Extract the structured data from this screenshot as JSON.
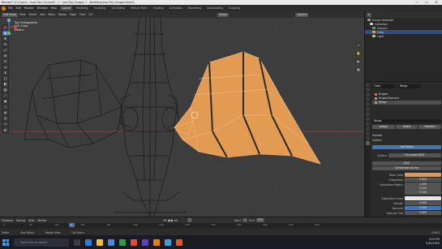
{
  "window": {
    "title": "Blender* [C:\\Users\\...\\Low Poly Course\\2 - 1 - Low Poly Dragon 1 - Modeling\\Low Poly Dragon.blend]",
    "controls": [
      "—",
      "☐",
      "✕"
    ]
  },
  "menubar": {
    "menus": [
      "File",
      "Edit",
      "Render",
      "Window",
      "Help"
    ],
    "workspaces": [
      "Layout",
      "Modeling",
      "Sculpting",
      "UV Editing",
      "Texture Paint",
      "Shading",
      "Animation",
      "Rendering",
      "Compositing",
      "Scripting"
    ],
    "active_workspace": "Layout"
  },
  "viewport_header": {
    "mode": "Edit Mode",
    "menus": [
      "View",
      "Select",
      "Add",
      "Mesh",
      "Vertex",
      "Edge",
      "Face",
      "UV"
    ],
    "transform": "Global",
    "shading": "Options"
  },
  "viewport": {
    "info_line1": "Top Orthographic",
    "info_line2": "(14) Cube",
    "info_line3": "Meters",
    "tools": [
      "cursor",
      "select",
      "move",
      "rotate",
      "scale",
      "transform",
      "annotate",
      "measure",
      "extrude",
      "inset",
      "bevel",
      "loopcut",
      "knife",
      "polybuild",
      "spin",
      "smooth",
      "shrink",
      "shear",
      "rip"
    ],
    "gizmo_labels": [
      "Z",
      "Y",
      "X"
    ],
    "colors": {
      "background": "#3d3d3d",
      "selected_face": "#e39a52",
      "wire": "#1b1b1b",
      "grid": "#454545",
      "axis_x": "#b23a3a"
    }
  },
  "outliner": {
    "title": "Scene Collection",
    "rows": [
      {
        "label": "Scene Collection",
        "color": "#9a9a9a",
        "selected": false
      },
      {
        "label": "Collection",
        "color": "#cfcfcf",
        "selected": false
      },
      {
        "label": "Camera",
        "color": "#5fa05f",
        "selected": false
      },
      {
        "label": "Cube",
        "color": "#e3994f",
        "selected": true
      },
      {
        "label": "Light",
        "color": "#d8c15a",
        "selected": false
      }
    ]
  },
  "properties": {
    "object_name": "Cube",
    "modifier_field": "Wings",
    "material_slots": [
      {
        "label": "Dragon",
        "color": "#e3994f",
        "selected": false
      },
      {
        "label": "DragonStomach",
        "color": "#b0b0b0",
        "selected": false
      },
      {
        "label": "Wings",
        "color": "#e3994f",
        "selected": true
      }
    ],
    "slot_buttons": [
      "Assign",
      "Select",
      "Deselect"
    ],
    "material_name": "Wings",
    "section_preview": "Preview",
    "section_surface": "Surface",
    "use_nodes": "Use Nodes",
    "surface_label": "Surface",
    "surface_value": "Principled BSDF",
    "distribution": "GGX",
    "subsurface_method": "Christensen-Burley",
    "fields": [
      {
        "label": "Base Color",
        "value": "",
        "type": "blue"
      },
      {
        "label": "Subsurface",
        "value": "0.000",
        "type": "normal"
      },
      {
        "label": "Subsurface Radius",
        "value": "1.000",
        "type": "normal"
      },
      {
        "label": "",
        "value": "0.200",
        "type": "normal"
      },
      {
        "label": "",
        "value": "0.100",
        "type": "normal"
      },
      {
        "label": "Subsurface Color",
        "value": "",
        "type": "dark"
      },
      {
        "label": "Metallic",
        "value": "0.000",
        "type": "normal"
      },
      {
        "label": "Specular",
        "value": "0.500",
        "type": "blue"
      },
      {
        "label": "Specular Tint",
        "value": "0.000",
        "type": "normal"
      },
      {
        "label": "Roughness",
        "value": "0.500",
        "type": "blue"
      },
      {
        "label": "Anisotropic",
        "value": "0.000",
        "type": "normal"
      }
    ]
  },
  "timeline": {
    "menus": [
      "Playback",
      "Keying",
      "View",
      "Marker"
    ],
    "ticks": [
      "0",
      "20",
      "40",
      "60",
      "80",
      "100",
      "120",
      "140",
      "160",
      "180",
      "200",
      "220",
      "240"
    ],
    "current_frame": "1",
    "start_label": "Start",
    "start": "1",
    "end_label": "End",
    "end": "250"
  },
  "statusbar": {
    "items": [
      "Select",
      "Box Select",
      "Rotate View",
      "Call Menu"
    ],
    "version": "2.90.0"
  },
  "taskbar": {
    "search_placeholder": "Type here to search",
    "time": "3:15 PM",
    "date": "9/30/2020"
  }
}
